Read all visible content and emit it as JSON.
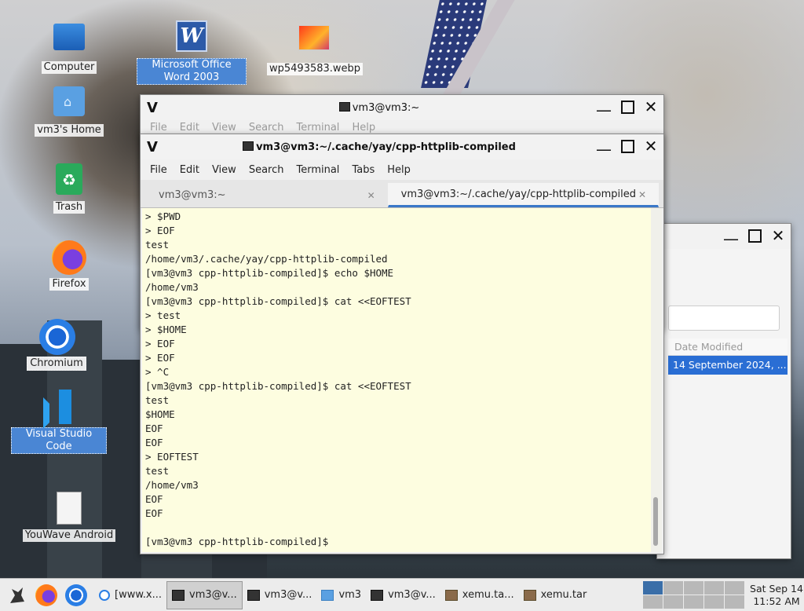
{
  "desktop": {
    "icons": [
      {
        "label": "Computer",
        "icon": "computer-icon"
      },
      {
        "label": "Microsoft Office Word 2003",
        "icon": "word-icon"
      },
      {
        "label": "wp5493583.webp",
        "icon": "image-icon"
      },
      {
        "label": "vm3's Home",
        "icon": "home-folder-icon"
      },
      {
        "label": "Trash",
        "icon": "trash-icon"
      },
      {
        "label": "Firefox",
        "icon": "firefox-icon"
      },
      {
        "label": "Chromium",
        "icon": "chromium-icon"
      },
      {
        "label": "Visual Studio Code",
        "icon": "vscode-icon"
      },
      {
        "label": "YouWave Android",
        "icon": "document-icon"
      }
    ]
  },
  "back_terminal": {
    "title": "vm3@vm3:~",
    "menu": [
      "File",
      "Edit",
      "View",
      "Search",
      "Terminal",
      "Help"
    ]
  },
  "file_manager": {
    "column_header": "Date Modified",
    "selected_row": "14 September 2024, ..."
  },
  "terminal": {
    "title": "vm3@vm3:~/.cache/yay/cpp-httplib-compiled",
    "menu": [
      "File",
      "Edit",
      "View",
      "Search",
      "Terminal",
      "Tabs",
      "Help"
    ],
    "tabs": [
      {
        "label": "vm3@vm3:~",
        "active": false
      },
      {
        "label": "vm3@vm3:~/.cache/yay/cpp-httplib-compiled",
        "active": true
      }
    ],
    "output": "> $PWD\n> EOF\ntest\n/home/vm3/.cache/yay/cpp-httplib-compiled\n[vm3@vm3 cpp-httplib-compiled]$ echo $HOME\n/home/vm3\n[vm3@vm3 cpp-httplib-compiled]$ cat <<EOFTEST\n> test\n> $HOME\n> EOF\n> EOF\n> ^C\n[vm3@vm3 cpp-httplib-compiled]$ cat <<EOFTEST\ntest\n$HOME\nEOF\nEOF\n> EOFTEST\ntest\n/home/vm3\nEOF\nEOF\n\n[vm3@vm3 cpp-httplib-compiled]$"
  },
  "taskbar": {
    "items": [
      {
        "label": "[www.x...",
        "icon": "globe-icon",
        "active": false
      },
      {
        "label": "vm3@v...",
        "icon": "terminal-icon",
        "active": true
      },
      {
        "label": "vm3@v...",
        "icon": "terminal-icon",
        "active": false
      },
      {
        "label": "vm3",
        "icon": "folder-icon",
        "active": false
      },
      {
        "label": "vm3@v...",
        "icon": "terminal-icon",
        "active": false
      },
      {
        "label": "xemu.ta...",
        "icon": "archive-icon",
        "active": false
      },
      {
        "label": "xemu.tar",
        "icon": "archive-icon",
        "active": false
      }
    ],
    "clock_date": "Sat Sep 14",
    "clock_time": "11:52 AM"
  }
}
